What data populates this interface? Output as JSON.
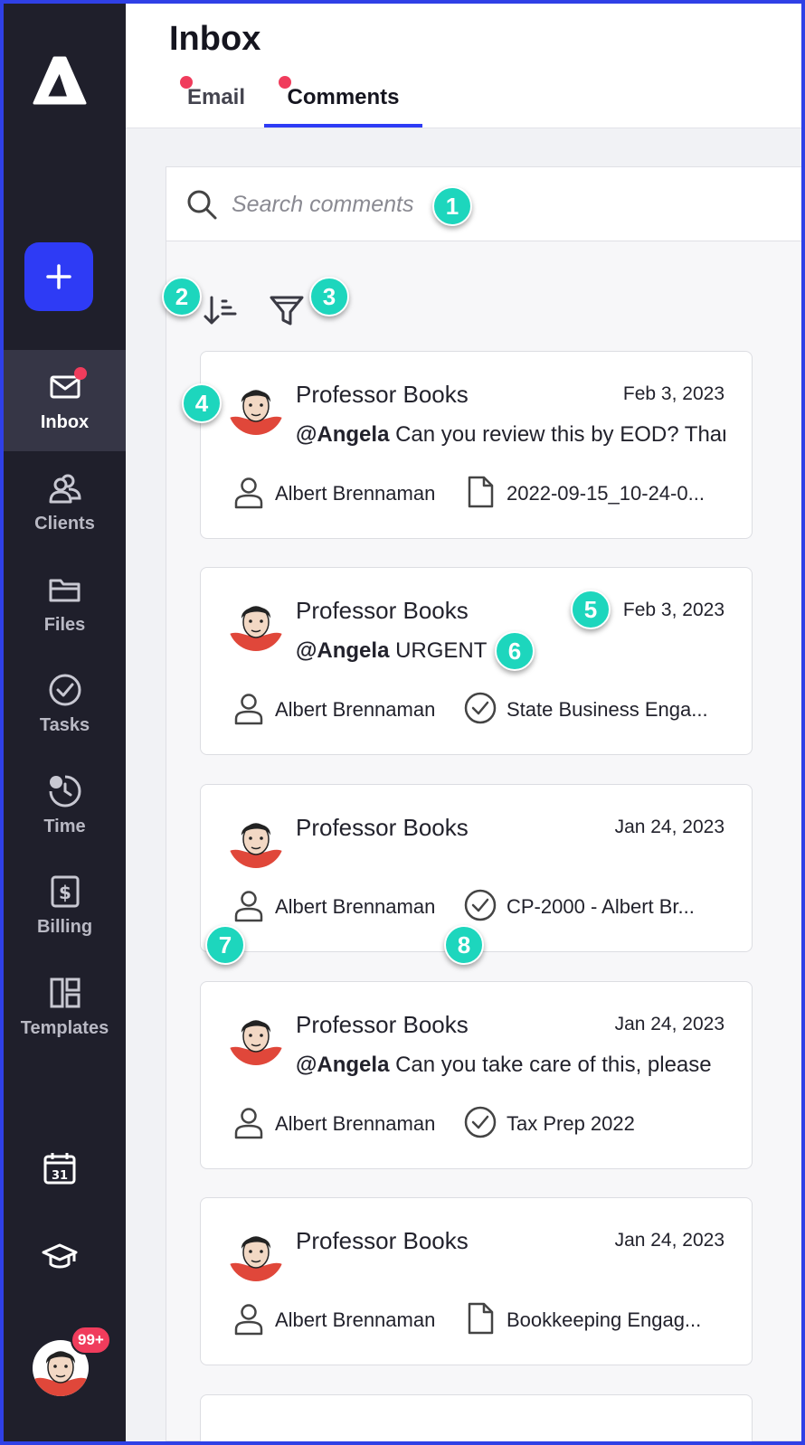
{
  "header": {
    "title": "Inbox",
    "tabs": [
      {
        "label": "Email",
        "unread": true
      },
      {
        "label": "Comments",
        "unread": true,
        "active": true
      }
    ]
  },
  "sidebar": {
    "new_button_icon": "plus-icon",
    "items": [
      {
        "label": "Inbox",
        "icon": "envelope-icon",
        "active": true,
        "has_notification": true
      },
      {
        "label": "Clients",
        "icon": "users-icon"
      },
      {
        "label": "Files",
        "icon": "folder-icon"
      },
      {
        "label": "Tasks",
        "icon": "check-circle-icon"
      },
      {
        "label": "Time",
        "icon": "clock-icon"
      },
      {
        "label": "Billing",
        "icon": "dollar-icon"
      },
      {
        "label": "Templates",
        "icon": "templates-icon"
      }
    ],
    "calendar_day": "31",
    "user_badge": "99+"
  },
  "search": {
    "placeholder": "Search comments"
  },
  "comments": [
    {
      "author": "Professor Books",
      "date": "Feb 3, 2023",
      "mention": "@Angela",
      "text": "Can you review this by EOD? Thanks",
      "client": "Albert Brennaman",
      "item_type": "file",
      "item": "2022-09-15_10-24-0..."
    },
    {
      "author": "Professor Books",
      "date": "Feb 3, 2023",
      "mention": "@Angela",
      "text": "URGENT",
      "client": "Albert Brennaman",
      "item_type": "task",
      "item": "State Business Enga..."
    },
    {
      "author": "Professor Books",
      "date": "Jan 24, 2023",
      "mention": "",
      "text": "",
      "client": "Albert Brennaman",
      "item_type": "task",
      "item": "CP-2000 - Albert Br..."
    },
    {
      "author": "Professor Books",
      "date": "Jan 24, 2023",
      "mention": "@Angela",
      "text": "Can you take care of this, please",
      "client": "Albert Brennaman",
      "item_type": "task",
      "item": "Tax Prep 2022"
    },
    {
      "author": "Professor Books",
      "date": "Jan 24, 2023",
      "mention": "",
      "text": "",
      "client": "Albert Brennaman",
      "item_type": "file",
      "item": "Bookkeeping Engag..."
    }
  ],
  "callouts": [
    "1",
    "2",
    "3",
    "4",
    "5",
    "6",
    "7",
    "8"
  ],
  "colors": {
    "sidebar_bg": "#1f1f2b",
    "accent": "#2e3bf5",
    "notification": "#f03c5c",
    "callout": "#1dd6bd",
    "frame_border": "#2f40e6"
  }
}
